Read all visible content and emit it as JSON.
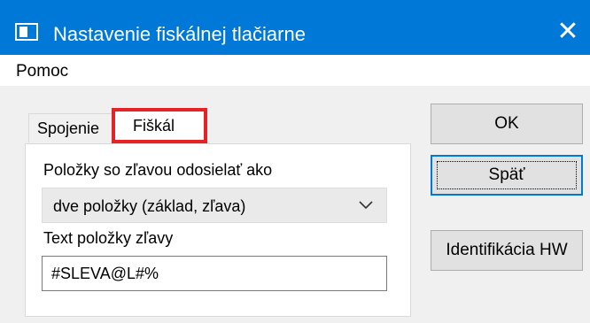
{
  "window": {
    "title": "Nastavenie fiskálnej tlačiarne",
    "close_glyph": "✕",
    "icon": "window-app-icon"
  },
  "menu": {
    "items": [
      {
        "label": "Pomoc"
      }
    ]
  },
  "tabs": [
    {
      "label": "Spojenie",
      "active": false
    },
    {
      "label": "Fiškál",
      "active": true,
      "highlighted": true,
      "highlight_color": "#e52226"
    }
  ],
  "form": {
    "discount_label": "Položky so zľavou odosielať ako",
    "discount_select_value": "dve položky (základ, zľava)",
    "discount_text_label": "Text položky zľavy",
    "discount_text_value": "#SLEVA@L#%"
  },
  "buttons": {
    "ok": "OK",
    "back": "Späť",
    "hw_id": "Identifikácia HW"
  },
  "colors": {
    "titlebar": "#0078d7",
    "highlight": "#e52226",
    "focus_border": "#0078d7"
  }
}
